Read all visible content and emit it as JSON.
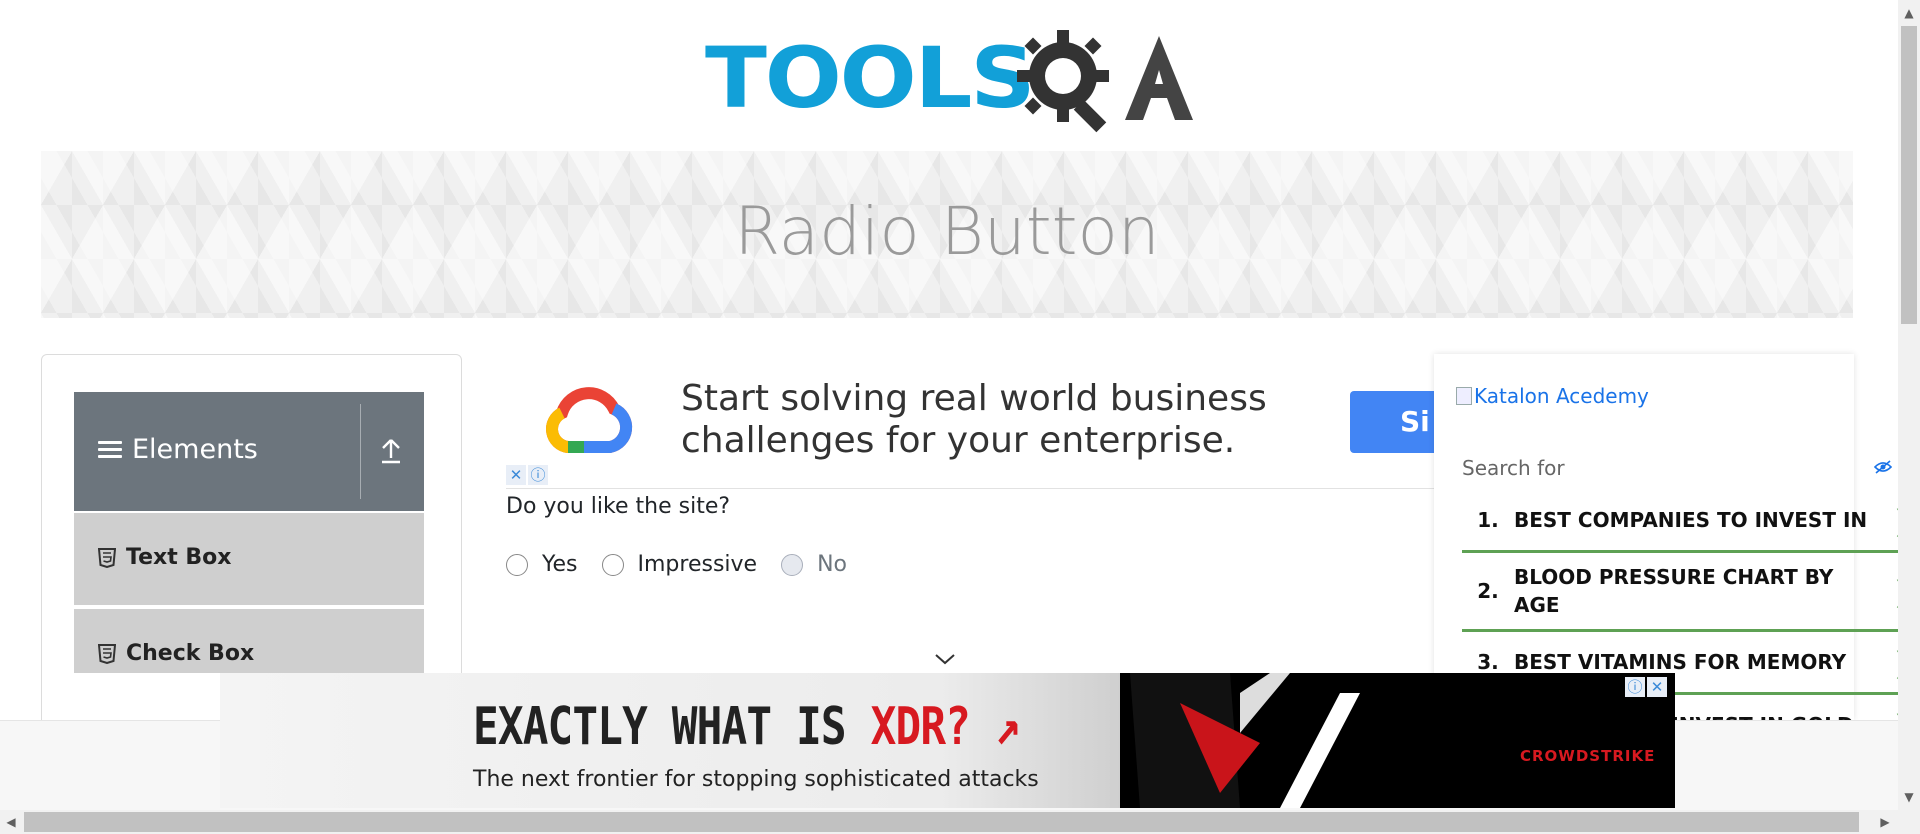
{
  "header": {
    "logo_alt": "TOOLSQA",
    "logo_part1": "TOOLS",
    "logo_part2": "QA"
  },
  "banner": {
    "title": "Radio Button"
  },
  "sidebar": {
    "group_label": "Elements",
    "items": [
      {
        "label": "Text Box"
      },
      {
        "label": "Check Box"
      }
    ]
  },
  "ad_top": {
    "headline_line1": "Start solving real world business",
    "headline_line2": "challenges for your enterprise.",
    "cta": "Si"
  },
  "form": {
    "question": "Do you like the site?",
    "options": [
      {
        "label": "Yes",
        "disabled": false
      },
      {
        "label": "Impressive",
        "disabled": false
      },
      {
        "label": "No",
        "disabled": true
      }
    ]
  },
  "right_ad": {
    "image_alt": "Katalon Acedemy",
    "search_label": "Search for",
    "items": [
      {
        "num": "1.",
        "text": "BEST COMPANIES TO INVEST IN"
      },
      {
        "num": "2.",
        "text": "BLOOD PRESSURE CHART BY AGE"
      },
      {
        "num": "3.",
        "text": "BEST VITAMINS FOR MEMORY"
      },
      {
        "num": "",
        "text": "INVEST IN GOLD"
      }
    ]
  },
  "bottom_ad": {
    "title_prefix": "EXACTLY WHAT IS ",
    "title_accent": "XDR? ↗",
    "subtitle": "The next frontier for stopping sophisticated attacks",
    "brand": "CROWDSTRIKE"
  },
  "colors": {
    "accent_blue": "#12a0d8",
    "sidebar_header": "#6c757d",
    "list_green": "#5ea154",
    "ad_red": "#d71920"
  }
}
